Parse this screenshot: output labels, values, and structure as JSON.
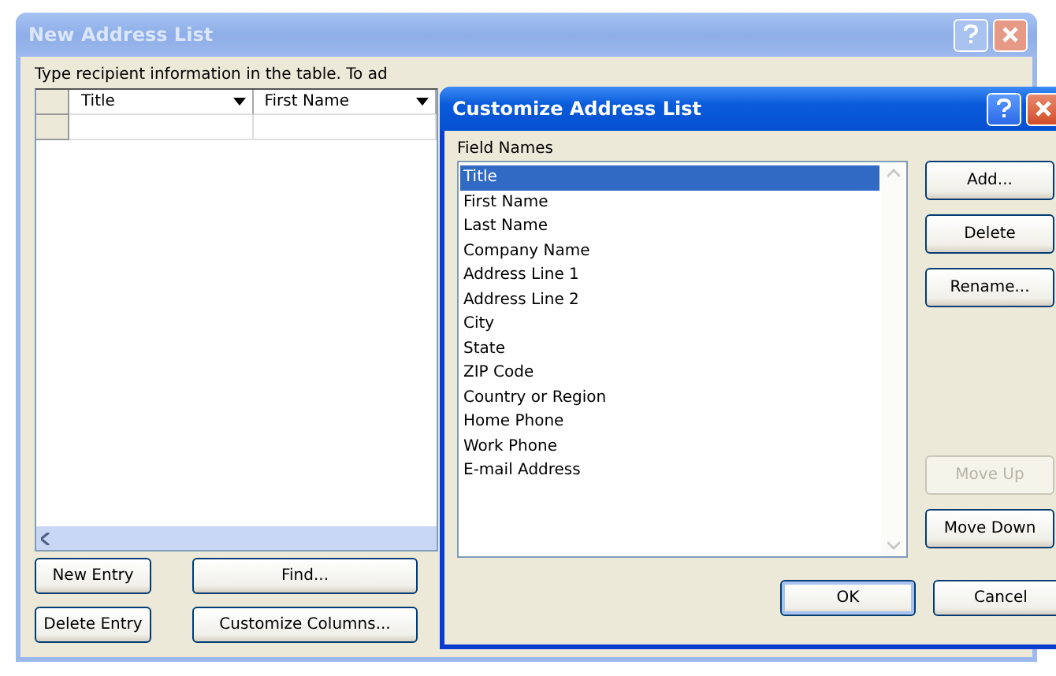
{
  "back_window": {
    "title": "New Address List",
    "active": false,
    "instruction": "Type recipient information in the table.  To ad",
    "table": {
      "columns": [
        "Title",
        "First Name"
      ]
    },
    "buttons": [
      {
        "label": "New Entry"
      },
      {
        "label": "Find..."
      },
      {
        "label": "Delete Entry"
      },
      {
        "label": "Customize Columns..."
      }
    ]
  },
  "dialog": {
    "title": "Customize Address List",
    "active": true,
    "list_label": "Field Names",
    "fields": [
      {
        "name": "Title",
        "selected": true
      },
      {
        "name": "First Name",
        "selected": false
      },
      {
        "name": "Last Name",
        "selected": false
      },
      {
        "name": "Company Name",
        "selected": false
      },
      {
        "name": "Address Line 1",
        "selected": false
      },
      {
        "name": "Address Line 2",
        "selected": false
      },
      {
        "name": "City",
        "selected": false
      },
      {
        "name": "State",
        "selected": false
      },
      {
        "name": "ZIP Code",
        "selected": false
      },
      {
        "name": "Country or Region",
        "selected": false
      },
      {
        "name": "Home Phone",
        "selected": false
      },
      {
        "name": "Work Phone",
        "selected": false
      },
      {
        "name": "E-mail Address",
        "selected": false
      }
    ],
    "side_buttons": [
      {
        "label": "Add...",
        "disabled": false
      },
      {
        "label": "Delete",
        "disabled": false
      },
      {
        "label": "Rename...",
        "disabled": false
      },
      {
        "label": "Move Up",
        "disabled": true
      },
      {
        "label": "Move Down",
        "disabled": false
      }
    ],
    "footer_buttons": [
      {
        "label": "OK",
        "default": true
      },
      {
        "label": "Cancel",
        "default": false
      }
    ]
  }
}
